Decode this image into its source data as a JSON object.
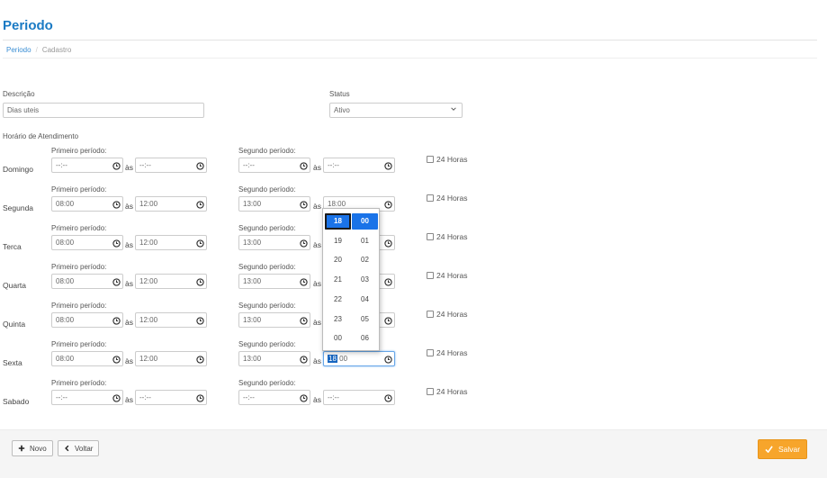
{
  "page": {
    "title": "Periodo"
  },
  "breadcrumb": {
    "home": "Periodo",
    "current": "Cadastro"
  },
  "form": {
    "description_label": "Descrição",
    "description_value": "Dias uteis",
    "status_label": "Status",
    "status_value": "Ativo",
    "schedule_label": "Horário de Atendimento"
  },
  "schedule": {
    "first_label": "Primeiro período:",
    "second_label": "Segundo período:",
    "between": "às",
    "h24_label": "24 Horas",
    "rows": [
      {
        "day": "Domingo",
        "p1_start": "--:--",
        "p1_end": "--:--",
        "p2_start": "--:--",
        "p2_end": "--:--"
      },
      {
        "day": "Segunda",
        "p1_start": "08:00",
        "p1_end": "12:00",
        "p2_start": "13:00",
        "p2_end": "18:00"
      },
      {
        "day": "Terca",
        "p1_start": "08:00",
        "p1_end": "12:00",
        "p2_start": "13:00",
        "p2_end": ""
      },
      {
        "day": "Quarta",
        "p1_start": "08:00",
        "p1_end": "12:00",
        "p2_start": "13:00",
        "p2_end": ""
      },
      {
        "day": "Quinta",
        "p1_start": "08:00",
        "p1_end": "12:00",
        "p2_start": "13:00",
        "p2_end": ""
      },
      {
        "day": "Sexta",
        "p1_start": "08:00",
        "p1_end": "12:00",
        "p2_start": "13:00",
        "p2_end_hour": "18",
        "p2_end_min": "00"
      },
      {
        "day": "Sabado",
        "p1_start": "--:--",
        "p1_end": "--:--",
        "p2_start": "--:--",
        "p2_end": "--:--"
      }
    ]
  },
  "time_picker": {
    "hours": [
      "18",
      "19",
      "20",
      "21",
      "22",
      "23",
      "00"
    ],
    "minutes": [
      "00",
      "01",
      "02",
      "03",
      "04",
      "05",
      "06"
    ],
    "selected_hour": "18",
    "selected_minute": "00"
  },
  "footer": {
    "new_label": "Novo",
    "back_label": "Voltar",
    "save_label": "Salvar"
  },
  "colors": {
    "accent": "#1a7ac4",
    "picker_selected": "#1a73e8",
    "save": "#f7a52b"
  }
}
